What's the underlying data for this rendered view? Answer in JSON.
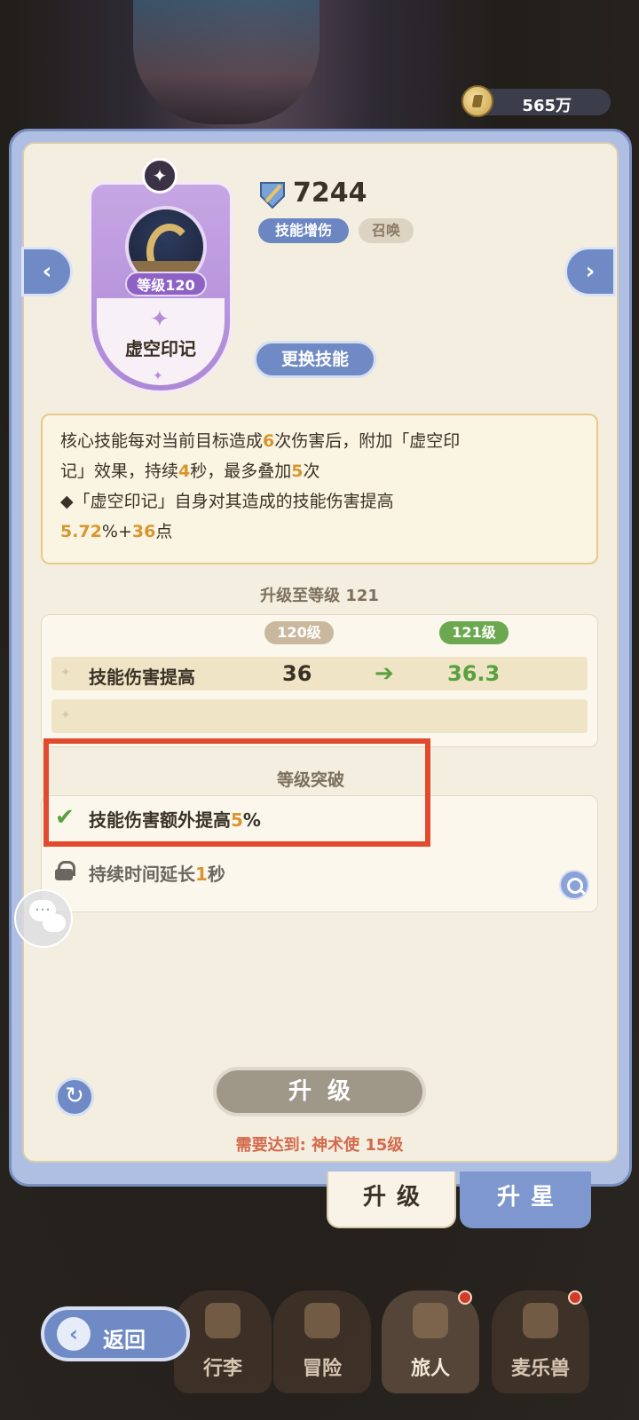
{
  "currency": {
    "icon": "coin-icon",
    "value": "565万"
  },
  "skill": {
    "power": "7244",
    "tags": [
      "技能增伤",
      "召唤"
    ],
    "level_label": "等级120",
    "name": "虚空印记",
    "change_button": "更换技能"
  },
  "description": {
    "line1": [
      "核心技能每对当前目标造成",
      "6",
      "次伤害后，附加「虚空印"
    ],
    "line2": [
      "记」效果，持续",
      "4",
      "秒，最多叠加",
      "5",
      "次"
    ],
    "line3": "◆「虚空印记」自身对其造成的技能伤害提高",
    "line4": [
      "5.72",
      "%+",
      "36",
      "点"
    ]
  },
  "upgrade": {
    "title": "升级至等级 121",
    "current_level": "120级",
    "next_level": "121级",
    "rows": [
      {
        "label": "技能伤害提高",
        "current": "36",
        "next": "36.3"
      }
    ]
  },
  "breakthrough": {
    "title": "等级突破",
    "items": [
      {
        "text": [
          "技能伤害额外提高",
          "5",
          "%"
        ],
        "unlocked": true
      },
      {
        "text": [
          "持续时间延长",
          "1",
          "秒"
        ],
        "unlocked": false
      }
    ]
  },
  "actions": {
    "upgrade_button": "升级",
    "requirement": "需要达到: 神术使 15级"
  },
  "tabs": {
    "upgrade": "升级",
    "star": "升星"
  },
  "bottom_nav": {
    "back": "返回",
    "items": [
      "行李",
      "冒险",
      "旅人",
      "麦乐兽"
    ],
    "active": "旅人"
  },
  "colors": {
    "accent_blue": "#6f8ac4",
    "highlight_orange": "#d9952e",
    "green": "#58a13e",
    "red_frame": "#e14a2d"
  }
}
